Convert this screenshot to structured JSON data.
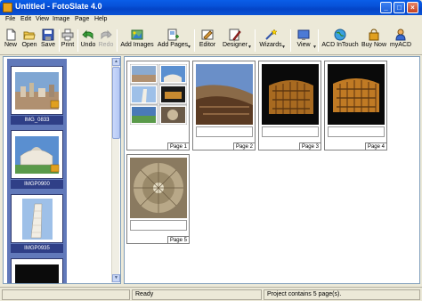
{
  "window": {
    "title": "Untitled - FotoSlate 4.0",
    "minimize": "_",
    "maximize": "□",
    "close": "×"
  },
  "menu": [
    "File",
    "Edit",
    "View",
    "Image",
    "Page",
    "Help"
  ],
  "toolbar": {
    "new": "New",
    "open": "Open",
    "save": "Save",
    "print": "Print",
    "undo": "Undo",
    "redo": "Redo",
    "add_images": "Add Images",
    "add_pages": "Add Pages",
    "editor": "Editor",
    "designer": "Designer",
    "wizards": "Wizards",
    "view": "View",
    "acd_intouch": "ACD InTouch",
    "buy_now": "Buy Now",
    "myacd": "myACD"
  },
  "thumbnails": [
    {
      "name": "IMG_0833"
    },
    {
      "name": "IMGP0900"
    },
    {
      "name": "IMGP0935"
    }
  ],
  "pages": [
    {
      "label": "Page 1"
    },
    {
      "label": "Page 2"
    },
    {
      "label": "Page 3"
    },
    {
      "label": "Page 4"
    },
    {
      "label": "Page 5"
    }
  ],
  "status": {
    "left": "",
    "middle": "Ready",
    "right": "Project contains 5 page(s)."
  },
  "colors": {
    "titlebar": "#0a5ee8",
    "thumb_bg": "#6179ba",
    "thumb_label": "#2f3f87"
  }
}
